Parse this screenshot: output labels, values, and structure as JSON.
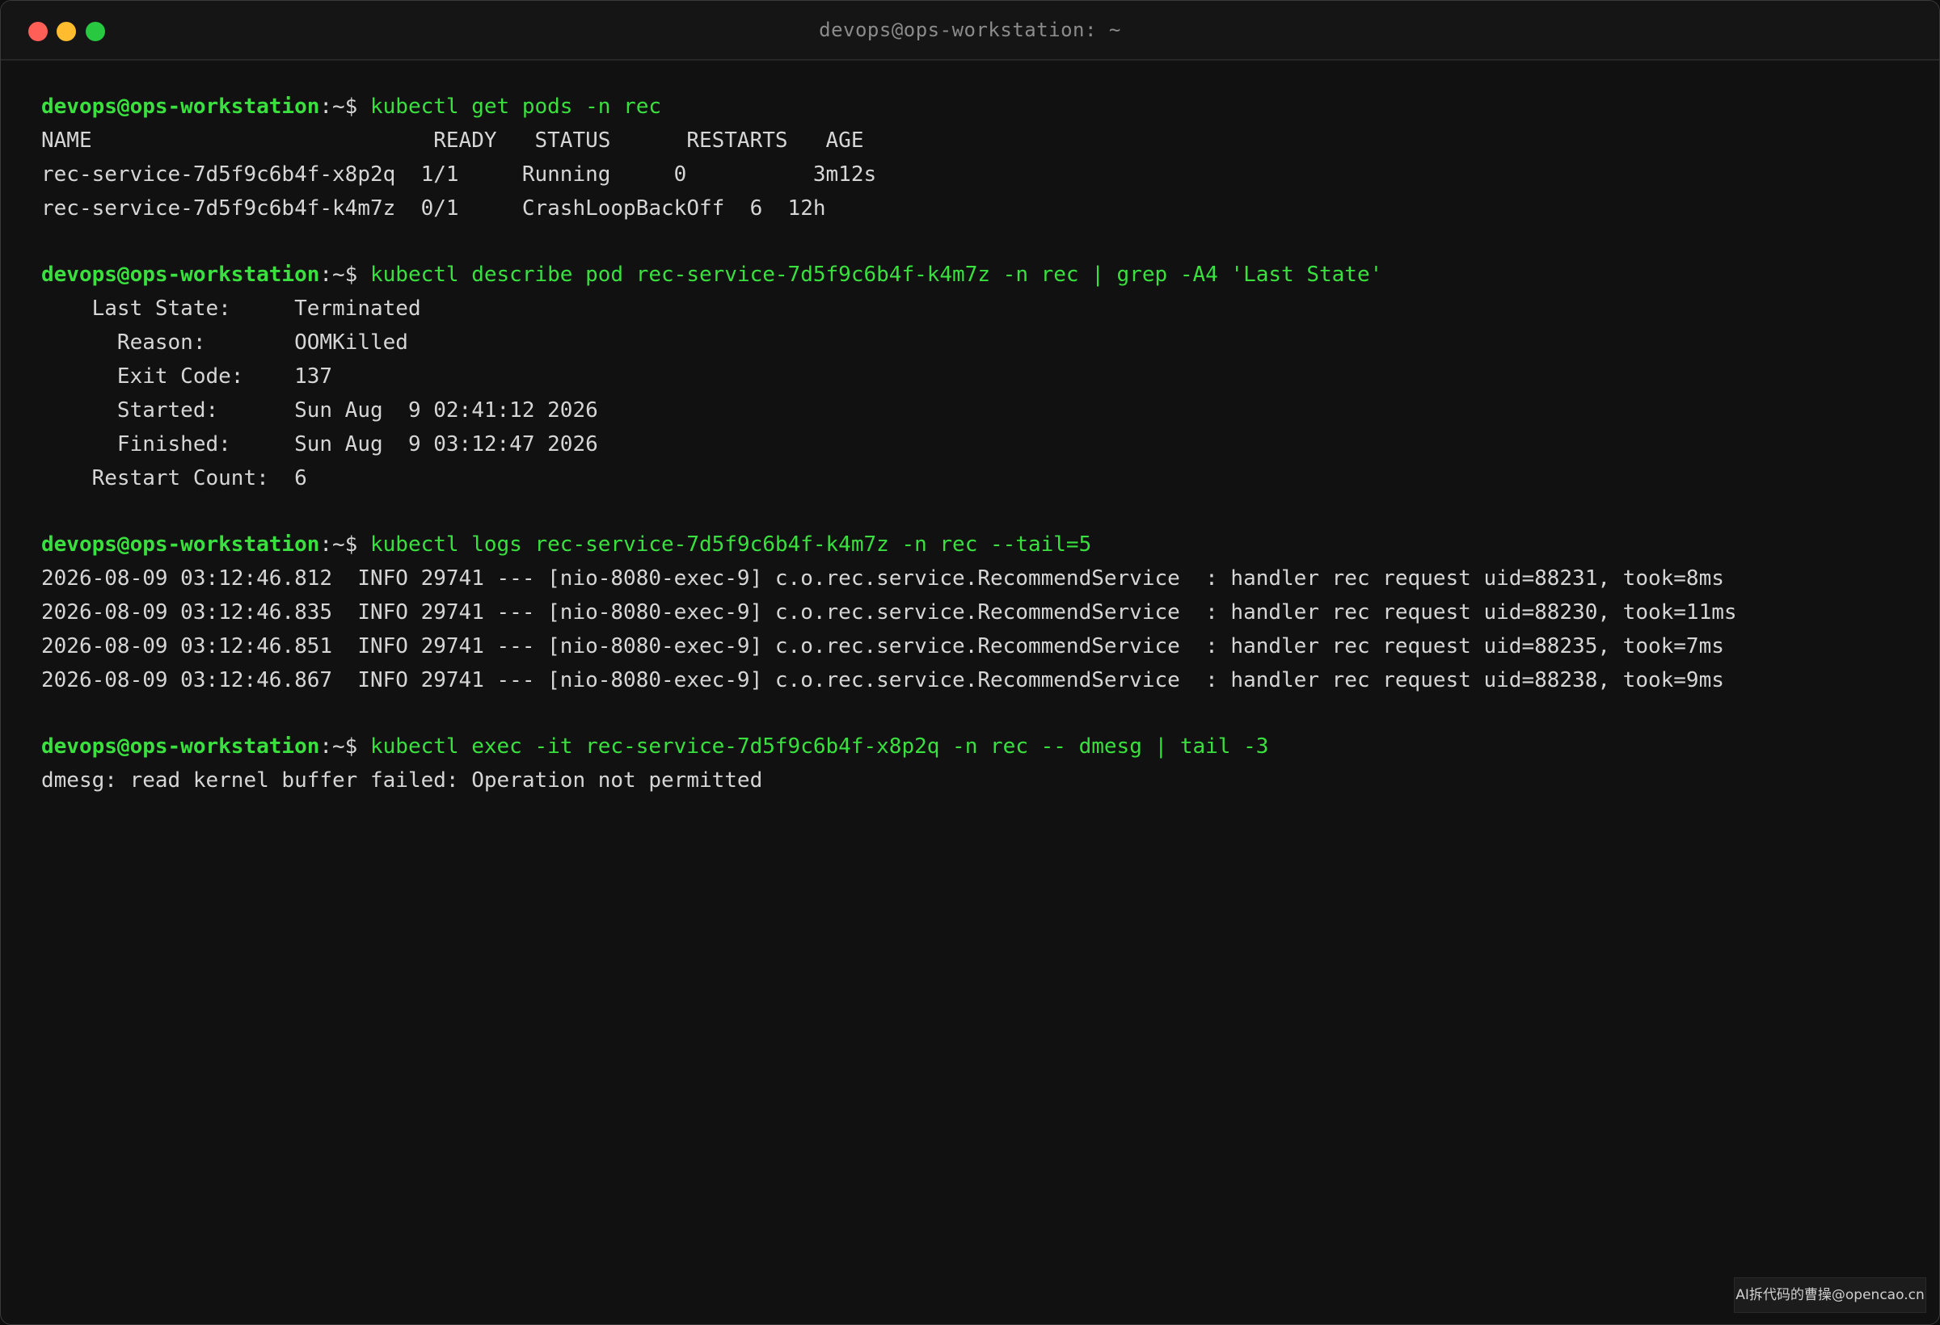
{
  "window": {
    "title": "devops@ops-workstation: ~",
    "traffic_lights": {
      "close_color": "#ff5f57",
      "minimize_color": "#febc2e",
      "maximize_color": "#28c840"
    }
  },
  "prompt": {
    "user_host": "devops@ops-workstation",
    "path_symbol": ":~$ "
  },
  "blocks": [
    {
      "command": "kubectl get pods -n rec",
      "output": [
        "NAME                           READY   STATUS      RESTARTS   AGE",
        "rec-service-7d5f9c6b4f-x8p2q  1/1     Running     0          3m12s",
        "rec-service-7d5f9c6b4f-k4m7z  0/1     CrashLoopBackOff  6  12h"
      ]
    },
    {
      "command": "kubectl describe pod rec-service-7d5f9c6b4f-k4m7z -n rec | grep -A4 'Last State'",
      "output": [
        "    Last State:     Terminated",
        "      Reason:       OOMKilled",
        "      Exit Code:    137",
        "      Started:      Sun Aug  9 02:41:12 2026",
        "      Finished:     Sun Aug  9 03:12:47 2026",
        "    Restart Count:  6"
      ]
    },
    {
      "command": "kubectl logs rec-service-7d5f9c6b4f-k4m7z -n rec --tail=5",
      "output": [
        "2026-08-09 03:12:46.812  INFO 29741 --- [nio-8080-exec-9] c.o.rec.service.RecommendService  : handler rec request uid=88231, took=8ms",
        "2026-08-09 03:12:46.835  INFO 29741 --- [nio-8080-exec-9] c.o.rec.service.RecommendService  : handler rec request uid=88230, took=11ms",
        "2026-08-09 03:12:46.851  INFO 29741 --- [nio-8080-exec-9] c.o.rec.service.RecommendService  : handler rec request uid=88235, took=7ms",
        "2026-08-09 03:12:46.867  INFO 29741 --- [nio-8080-exec-9] c.o.rec.service.RecommendService  : handler rec request uid=88238, took=9ms"
      ]
    },
    {
      "command": "kubectl exec -it rec-service-7d5f9c6b4f-x8p2q -n rec -- dmesg | tail -3",
      "output": [
        "dmesg: read kernel buffer failed: Operation not permitted"
      ]
    }
  ],
  "watermark": "AI拆代码的曹操@opencao.cn"
}
